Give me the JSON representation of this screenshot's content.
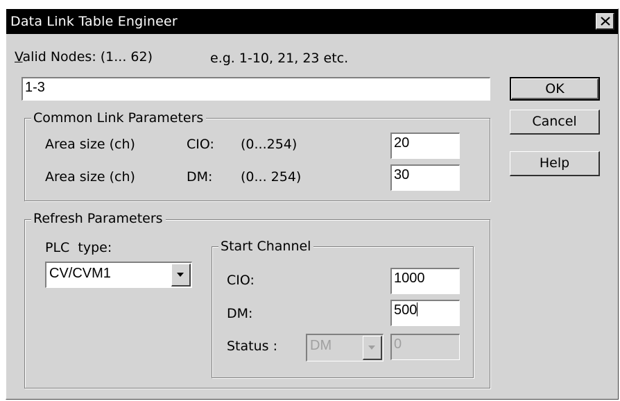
{
  "window": {
    "title": "Data Link Table Engineer"
  },
  "valid_nodes": {
    "label_accel": "V",
    "label_rest": "alid Nodes: (1... 62)",
    "hint": "e.g. 1-10, 21, 23 etc.",
    "value": "1-3"
  },
  "common": {
    "legend_accel": "C",
    "legend_rest": "ommon Link Parameters",
    "rows": [
      {
        "label": "Area size (ch)",
        "area": "CIO:",
        "range": "(0...254)",
        "value": "20"
      },
      {
        "label": "Area size (ch)",
        "area": "DM:",
        "range": "(0... 254)",
        "value": "30"
      }
    ]
  },
  "refresh": {
    "legend_accel": "R",
    "legend_rest": "efresh Parameters",
    "plc_label": "PLC  type:",
    "plc_value": "CV/CVM1",
    "start": {
      "legend_accel": "S",
      "legend_rest": "tart Channel",
      "cio_label": "CIO:",
      "cio_value": "1000",
      "dm_label": "DM:",
      "dm_value": "500",
      "status_label": "Status :",
      "status_combo": "DM",
      "status_value": "0"
    }
  },
  "buttons": {
    "ok": "OK",
    "cancel": "Cancel",
    "help_accel": "H",
    "help_rest": "elp"
  },
  "icons": {
    "close": "close-icon",
    "dropdown": "chevron-down-icon"
  },
  "colors": {
    "titlebar": "#000000",
    "face": "#d4d4d4",
    "disabled_text": "#a0a0a0"
  }
}
